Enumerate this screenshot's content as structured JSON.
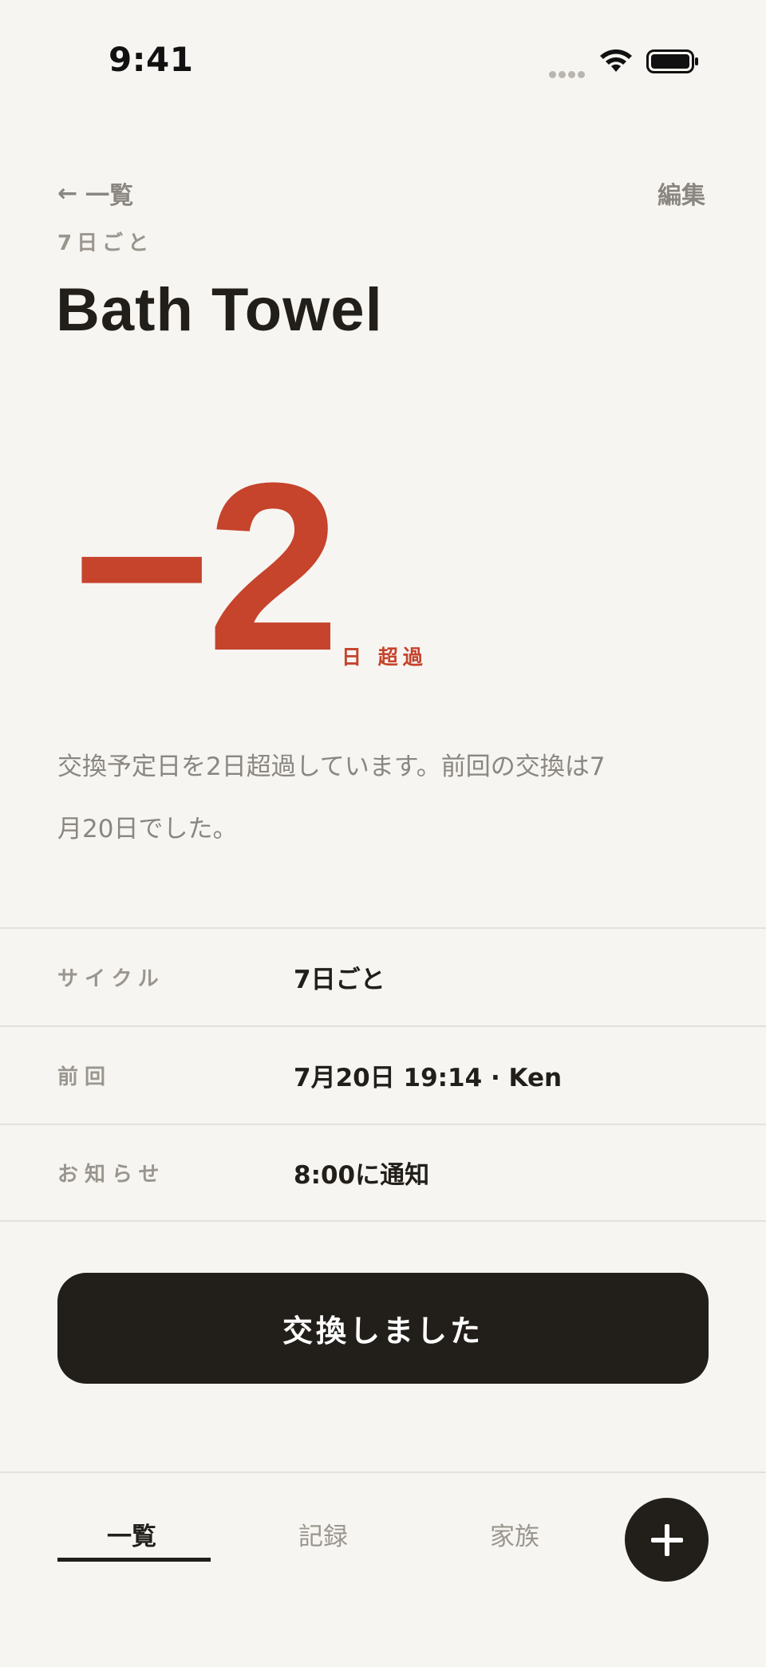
{
  "status_bar": {
    "time": "9:41"
  },
  "header": {
    "back_arrow": "←",
    "back_label": "一覧",
    "edit_label": "編集",
    "cycle_label": "7日ごと",
    "title": "Bath Towel"
  },
  "countdown": {
    "value": "−2",
    "unit": "日 超過"
  },
  "description": "交換予定日を2日超過しています。前回の交換は7月20日でした。",
  "details": [
    {
      "label": "サイクル",
      "value": "7日ごと"
    },
    {
      "label": "前回",
      "value": "7月20日 19:14 · Ken"
    },
    {
      "label": "お知らせ",
      "value": "8:00に通知"
    }
  ],
  "primary_action": "交換しました",
  "tabs": [
    {
      "label": "一覧",
      "active": true
    },
    {
      "label": "記録",
      "active": false
    },
    {
      "label": "家族",
      "active": false
    }
  ],
  "fab_icon": "plus-icon",
  "colors": {
    "accent": "#c6432c",
    "dark": "#221f1b",
    "background": "#f7f5f1",
    "muted": "#8a8681"
  }
}
